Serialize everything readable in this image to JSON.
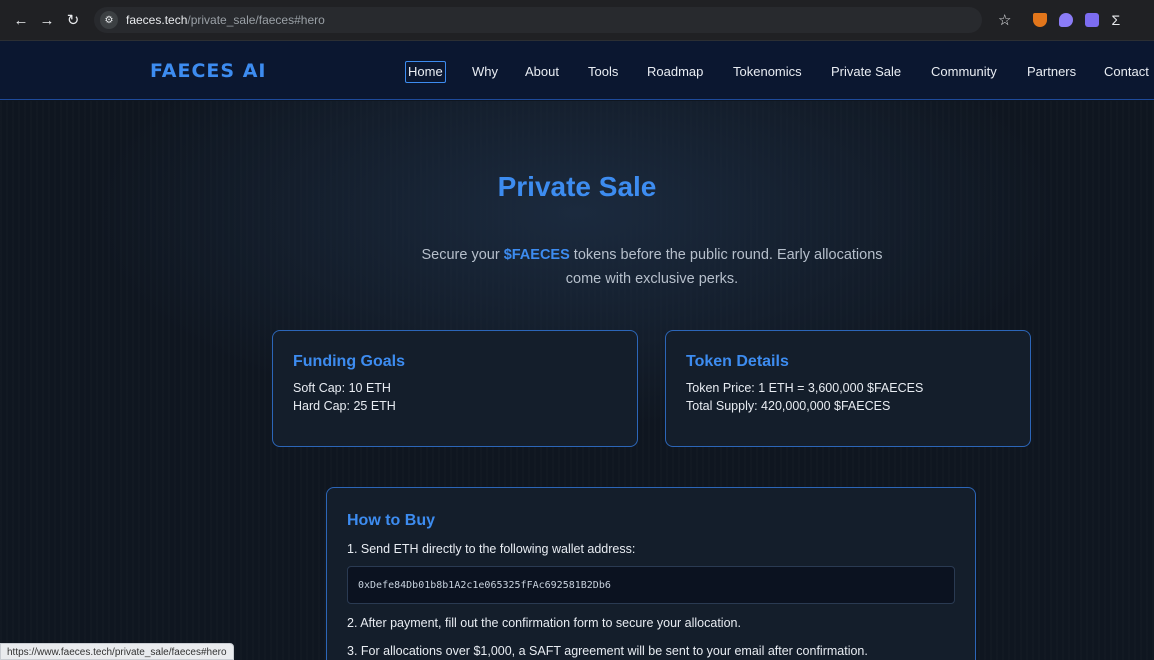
{
  "browser": {
    "back_icon": "←",
    "forward_icon": "→",
    "reload_icon": "↻",
    "url_host": "faeces.tech",
    "url_path": "/private_sale/faeces#hero",
    "star_icon": "☆",
    "puzzle_icon": "Σ"
  },
  "header": {
    "logo": "FAECES AI",
    "nav": [
      "Home",
      "Why",
      "About",
      "Tools",
      "Roadmap",
      "Tokenomics",
      "Private Sale",
      "Community",
      "Partners",
      "Contact"
    ]
  },
  "hero": {
    "title": "Private Sale",
    "subtitle_pre": "Secure your ",
    "subtitle_token": "$FAECES",
    "subtitle_post": " tokens before the public round. Early allocations come with exclusive perks."
  },
  "funding": {
    "title": "Funding Goals",
    "soft_cap": "Soft Cap: 10 ETH",
    "hard_cap": "Hard Cap: 25 ETH"
  },
  "token": {
    "title": "Token Details",
    "price": "Token Price: 1 ETH = 3,600,000 $FAECES",
    "supply": "Total Supply: 420,000,000 $FAECES"
  },
  "how_to_buy": {
    "title": "How to Buy",
    "step1": "1. Send ETH directly to the following wallet address:",
    "wallet": "0xDefe84Db01b8b1A2c1e065325fFAc692581B2Db6",
    "step2": "2. After payment, fill out the confirmation form to secure your allocation.",
    "step3": "3. For allocations over $1,000, a SAFT agreement will be sent to your email after confirmation."
  },
  "status_bar": {
    "url": "https://www.faeces.tech/private_sale/faeces#hero"
  },
  "colors": {
    "accent": "#3d8cf0",
    "background": "#0f1620",
    "card_border": "#2c66b8"
  }
}
